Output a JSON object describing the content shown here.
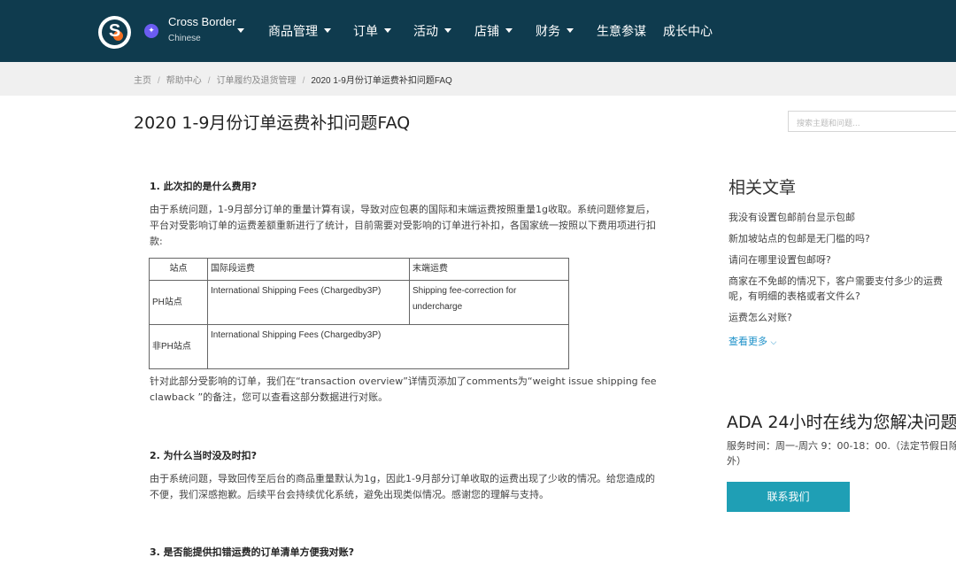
{
  "header": {
    "logo_icon": "shopee-s-logo-icon",
    "store": {
      "name": "Cross Border",
      "language": "Chinese"
    },
    "nav": [
      {
        "label": "商品管理",
        "has_caret": true
      },
      {
        "label": "订单",
        "has_caret": true
      },
      {
        "label": "活动",
        "has_caret": true
      },
      {
        "label": "店铺",
        "has_caret": true
      },
      {
        "label": "财务",
        "has_caret": true
      },
      {
        "label": "生意参谋",
        "has_caret": false
      },
      {
        "label": "成长中心",
        "has_caret": false
      }
    ],
    "colors": {
      "background": "#0f3b4e",
      "accent": "#f36f21"
    }
  },
  "breadcrumb": [
    "主页",
    "帮助中心",
    "订单履约及退货管理",
    "2020 1-9月份订单运费补扣问题FAQ"
  ],
  "page_title": "2020 1-9月份订单运费补扣问题FAQ",
  "search": {
    "placeholder": "搜索主题和问题..."
  },
  "article": {
    "q1": {
      "heading": "1. 此次扣的是什么费用?",
      "intro": "由于系统问题，1-9月部分订单的重量计算有误，导致对应包裹的国际和末端运费按照重量1g收取。系统问题修复后，平台对受影响订单的运费差额重新进行了统计，目前需要对受影响的订单进行补扣，各国家统一按照以下费用项进行扣款:",
      "table": {
        "headers": [
          "站点",
          "国际段运费",
          "末端运费"
        ],
        "rows": [
          [
            "PH站点",
            "International Shipping Fees (Chargedby3P)",
            "Shipping fee-correction for undercharge"
          ],
          [
            "非PH站点",
            "International Shipping Fees (Chargedby3P)",
            ""
          ]
        ]
      },
      "note": "针对此部分受影响的订单，我们在“transaction overview”详情页添加了comments为“weight issue shipping fee clawback ”的备注，您可以查看这部分数据进行对账。"
    },
    "q2": {
      "heading": "2. 为什么当时没及时扣?",
      "body": "由于系统问题，导致回传至后台的商品重量默认为1g，因此1-9月部分订单收取的运费出现了少收的情况。给您造成的不便，我们深感抱歉。后续平台会持续优化系统，避免出现类似情况。感谢您的理解与支持。"
    },
    "q3": {
      "heading": "3. 是否能提供扣错运费的订单清单方便我对账?"
    }
  },
  "sidebar": {
    "related_heading": "相关文章",
    "related": [
      "我没有设置包邮前台显示包邮",
      "新加坡站点的包邮是无门槛的吗?",
      "请问在哪里设置包邮呀?",
      "商家在不免邮的情况下，客户需要支付多少的运费呢，有明细的表格或者文件么?",
      "运费怎么对账?"
    ],
    "more_label": "查看更多",
    "ada_heading": "ADA 24小时在线为您解决问题",
    "service_time": "服务时间：周一-周六 9：00-18：00.（法定节假日除外）",
    "contact_label": "联系我们",
    "colors": {
      "link": "#1a8fc8",
      "button": "#1f9fb5"
    }
  }
}
